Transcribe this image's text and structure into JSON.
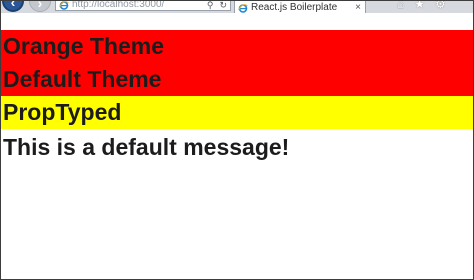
{
  "browser": {
    "address_url": "http://localhost:3000/",
    "tab_title": "React.js Boilerplate",
    "tab_close": "×",
    "search_icon": "⚲",
    "refresh_icon": "↻",
    "home_icon": "⌂",
    "favorites_icon": "★",
    "settings_icon": "⚙",
    "back_icon": "‹",
    "forward_icon": "›"
  },
  "page": {
    "blocks": [
      {
        "label": "Orange Theme",
        "background": "#ff0000"
      },
      {
        "label": "Default Theme",
        "background": "#ff0000"
      },
      {
        "label": "PropTyped",
        "background": "#ffff00"
      }
    ],
    "message": "This is a default message!"
  }
}
